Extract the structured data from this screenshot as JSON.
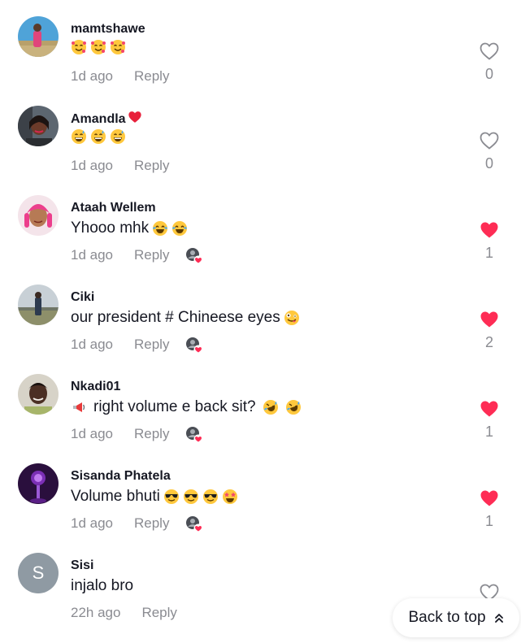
{
  "colors": {
    "liked": "#fe2c55",
    "muted": "#8a8b91",
    "text": "#161823"
  },
  "comments": [
    {
      "username": "mamtshawe",
      "text": "",
      "emojis": [
        "smiling-face-with-hearts-emoji",
        "smiling-face-with-hearts-emoji",
        "smiling-face-with-hearts-emoji"
      ],
      "time": "1d ago",
      "reply": "Reply",
      "likes": "0",
      "liked": false,
      "creator_liked": false
    },
    {
      "username": "Amandla",
      "username_badge": "red-heart-icon",
      "text": "",
      "emojis": [
        "grinning-sweat-emoji",
        "grinning-sweat-emoji",
        "grinning-sweat-emoji"
      ],
      "time": "1d ago",
      "reply": "Reply",
      "likes": "0",
      "liked": false,
      "creator_liked": false
    },
    {
      "username": "Ataah Wellem",
      "text": "Yhooo mhk",
      "emojis": [
        "tears-of-joy-emoji",
        "tears-of-joy-emoji"
      ],
      "time": "1d ago",
      "reply": "Reply",
      "likes": "1",
      "liked": true,
      "creator_liked": true
    },
    {
      "username": "Ciki",
      "text": "our president # Chineese eyes",
      "emojis": [
        "zany-face-emoji"
      ],
      "time": "1d ago",
      "reply": "Reply",
      "likes": "2",
      "liked": true,
      "creator_liked": true
    },
    {
      "username": "Nkadi01",
      "text": "right volume e back sit?",
      "lead_emoji": "loudspeaker-emoji",
      "emojis": [
        "rolling-laughing-emoji",
        "rolling-laughing-emoji"
      ],
      "time": "1d ago",
      "reply": "Reply",
      "likes": "1",
      "liked": true,
      "creator_liked": true
    },
    {
      "username": "Sisanda Phatela",
      "text": "Volume bhuti",
      "emojis": [
        "sunglasses-emoji",
        "sunglasses-emoji",
        "sunglasses-emoji",
        "star-struck-emoji"
      ],
      "time": "1d ago",
      "reply": "Reply",
      "likes": "1",
      "liked": true,
      "creator_liked": true
    },
    {
      "username": "Sisi",
      "avatar_letter": "S",
      "text": "injalo bro",
      "emojis": [],
      "time": "22h ago",
      "reply": "Reply",
      "likes": "",
      "liked": false,
      "creator_liked": false
    }
  ],
  "back_to_top": {
    "label": "Back to top"
  }
}
